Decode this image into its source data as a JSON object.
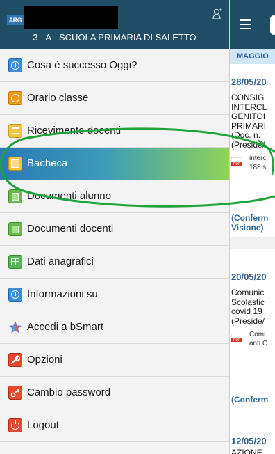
{
  "sidebar": {
    "logo_text": "ARG",
    "school_title": "3 - A - SCUOLA PRIMARIA DI SALETTO",
    "items": [
      {
        "label": "Cosa è successo Oggi?",
        "icon": "info-icon"
      },
      {
        "label": "Orario classe",
        "icon": "clock-icon"
      },
      {
        "label": "Ricevimento docenti",
        "icon": "document-icon"
      },
      {
        "label": "Bacheca",
        "icon": "board-icon"
      },
      {
        "label": "Documenti alunno",
        "icon": "documents-icon"
      },
      {
        "label": "Documenti docenti",
        "icon": "documents-icon"
      },
      {
        "label": "Dati anagrafici",
        "icon": "table-icon"
      },
      {
        "label": "Informazioni su",
        "icon": "info-icon"
      },
      {
        "label": "Accedi a bSmart",
        "icon": "bsmart-icon"
      },
      {
        "label": "Opzioni",
        "icon": "wrench-icon"
      },
      {
        "label": "Cambio password",
        "icon": "key-icon"
      },
      {
        "label": "Logout",
        "icon": "power-icon"
      }
    ],
    "active_index": 3
  },
  "main": {
    "month_label": "MAGGIO",
    "posts": [
      {
        "date": "28/05/20",
        "lines": [
          "CONSIG",
          "INTERCL",
          "GENITOI",
          "PRIMARI",
          "(Doc. n.",
          "(Preside/"
        ],
        "attachment": [
          "intercl",
          "188  s"
        ],
        "confirm": [
          "(Conferm",
          "Visione)"
        ]
      },
      {
        "date": "20/05/20",
        "lines": [
          "Comunic",
          "Scolastic",
          "covid 19",
          "(Preside/"
        ],
        "attachment": [
          "Comu",
          "anti C"
        ],
        "confirm": [
          "(Conferm"
        ]
      },
      {
        "date": "12/05/20",
        "lines": [
          "AZIONE"
        ]
      }
    ]
  },
  "colors": {
    "header": "#1f4e66",
    "active_gradient_start": "#2a7bb7",
    "active_gradient_end": "#8fd35a",
    "month_bar": "#cfe7f6",
    "annotation": "#1fa33a"
  }
}
